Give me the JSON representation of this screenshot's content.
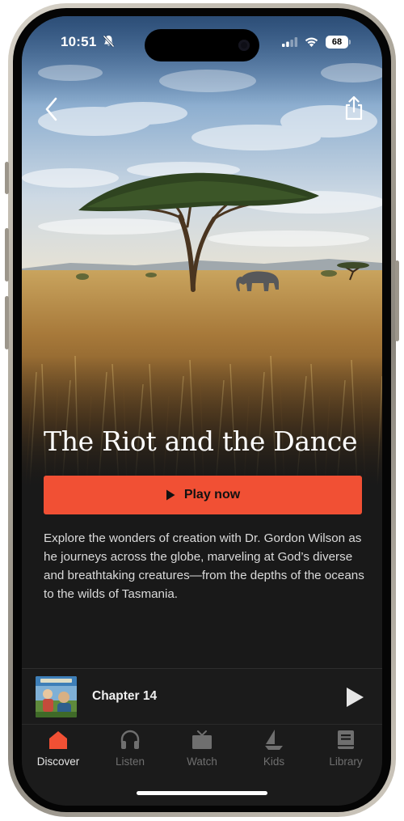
{
  "status_bar": {
    "time": "10:51",
    "battery": "68"
  },
  "hero": {
    "title": "The Riot and the Dance",
    "play_label": "Play now",
    "description": "Explore the wonders of creation with Dr. Gordon Wilson as he journeys across the globe, marveling at God’s diverse and breathtaking creatures—from the depths of the oceans to the wilds of Tasmania."
  },
  "mini_player": {
    "title": "Chapter 14"
  },
  "tabbar": {
    "items": [
      {
        "label": "Discover",
        "icon": "home-icon"
      },
      {
        "label": "Listen",
        "icon": "headphones-icon"
      },
      {
        "label": "Watch",
        "icon": "tv-icon"
      },
      {
        "label": "Kids",
        "icon": "sailboat-icon"
      },
      {
        "label": "Library",
        "icon": "book-icon"
      }
    ]
  },
  "colors": {
    "accent": "#f15034",
    "background": "#191919",
    "tab_inactive": "#6f6f6f",
    "tab_active": "#e6e6e6"
  }
}
